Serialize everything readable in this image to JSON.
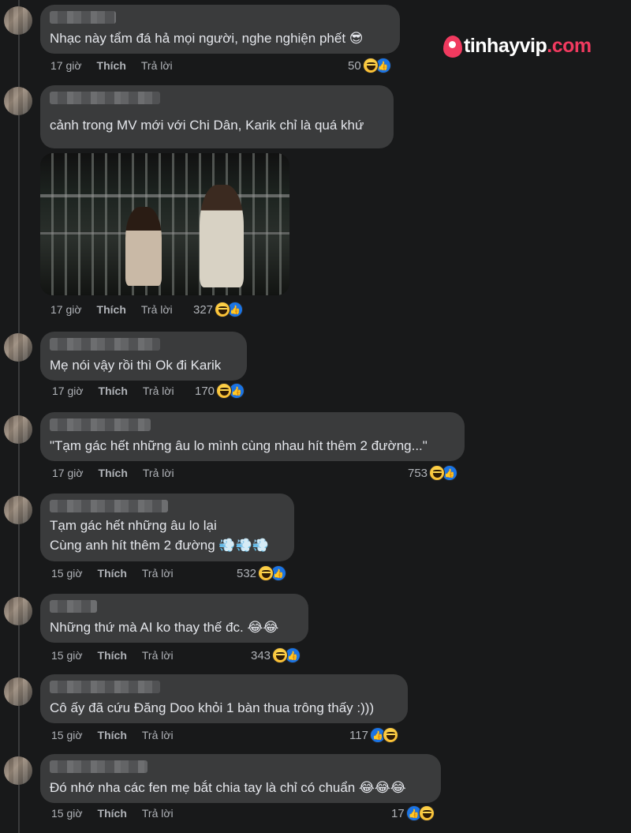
{
  "watermark": {
    "brand": "tinhayvip",
    "domain": ".com"
  },
  "labels": {
    "like": "Thích",
    "reply": "Trả lời"
  },
  "comments": [
    {
      "text": "Nhạc này tẩm đá hả mọi người, nghe nghiện phết 😎",
      "time": "17 giờ",
      "reactions": "50"
    },
    {
      "text": "cảnh trong MV mới với Chi Dân, Karik chỉ là quá khứ",
      "time": "17 giờ",
      "reactions": "327"
    },
    {
      "text": "Mẹ nói vậy rồi thì Ok đi Karik",
      "time": "17 giờ",
      "reactions": "170"
    },
    {
      "text": "\"Tạm gác hết những âu lo mình cùng nhau hít thêm 2 đường...\"",
      "time": "17 giờ",
      "reactions": "753"
    },
    {
      "text": "Tạm gác hết những âu lo lại\nCùng anh hít thêm 2 đường 💨💨💨",
      "time": "15 giờ",
      "reactions": "532"
    },
    {
      "text": "Những thứ mà AI ko thay thế đc. 😂😂",
      "time": "15 giờ",
      "reactions": "343"
    },
    {
      "text": "Cô ấy đã cứu Đăng Doo khỏi 1 bàn thua trông thấy :)))",
      "time": "15 giờ",
      "reactions": "117"
    },
    {
      "text": "Đó nhớ nha các fen mẹ bắt chia tay là chỉ có chuẩn 😂😂😂",
      "time": "15 giờ",
      "reactions": "17"
    }
  ],
  "icons": {
    "reaction_haha": "haha-icon",
    "reaction_like": "like-icon"
  },
  "colors": {
    "background": "#18191a",
    "bubble": "#3a3b3c",
    "like_blue": "#1b74e4",
    "brand_pink": "#f03a5f"
  }
}
